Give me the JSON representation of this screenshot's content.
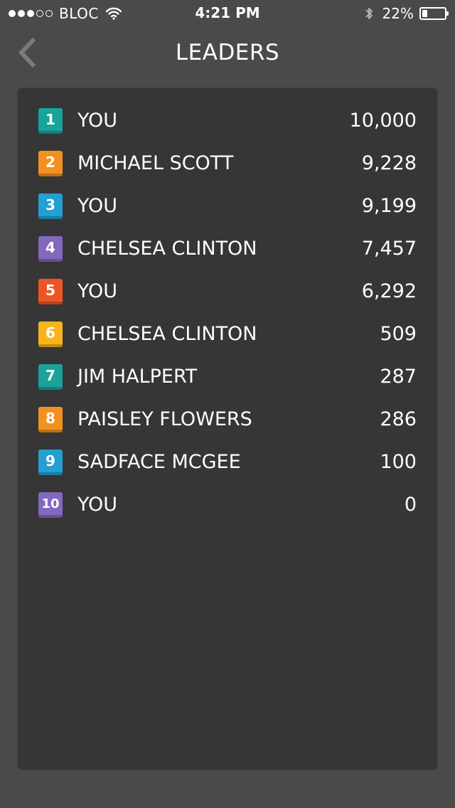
{
  "status_bar": {
    "signal": {
      "filled": 3,
      "total": 5
    },
    "carrier": "BLOC",
    "time": "4:21 PM",
    "battery_percent": "22%",
    "battery_level": 0.22
  },
  "nav": {
    "title": "LEADERS",
    "back_icon": "chevron-left-icon"
  },
  "leaderboard": [
    {
      "rank": "1",
      "name": "YOU",
      "score": "10,000",
      "color": "#1aa39a"
    },
    {
      "rank": "2",
      "name": "MICHAEL SCOTT",
      "score": "9,228",
      "color": "#f3911f"
    },
    {
      "rank": "3",
      "name": "YOU",
      "score": "9,199",
      "color": "#239fd1"
    },
    {
      "rank": "4",
      "name": "CHELSEA CLINTON",
      "score": "7,457",
      "color": "#8467bf"
    },
    {
      "rank": "5",
      "name": "YOU",
      "score": "6,292",
      "color": "#ef5524"
    },
    {
      "rank": "6",
      "name": "CHELSEA CLINTON",
      "score": "509",
      "color": "#f7b41c"
    },
    {
      "rank": "7",
      "name": "JIM HALPERT",
      "score": "287",
      "color": "#1aa39a"
    },
    {
      "rank": "8",
      "name": "PAISLEY FLOWERS",
      "score": "286",
      "color": "#f3911f"
    },
    {
      "rank": "9",
      "name": "SADFACE MCGEE",
      "score": "100",
      "color": "#239fd1"
    },
    {
      "rank": "10",
      "name": "YOU",
      "score": "0",
      "color": "#8467bf"
    }
  ]
}
